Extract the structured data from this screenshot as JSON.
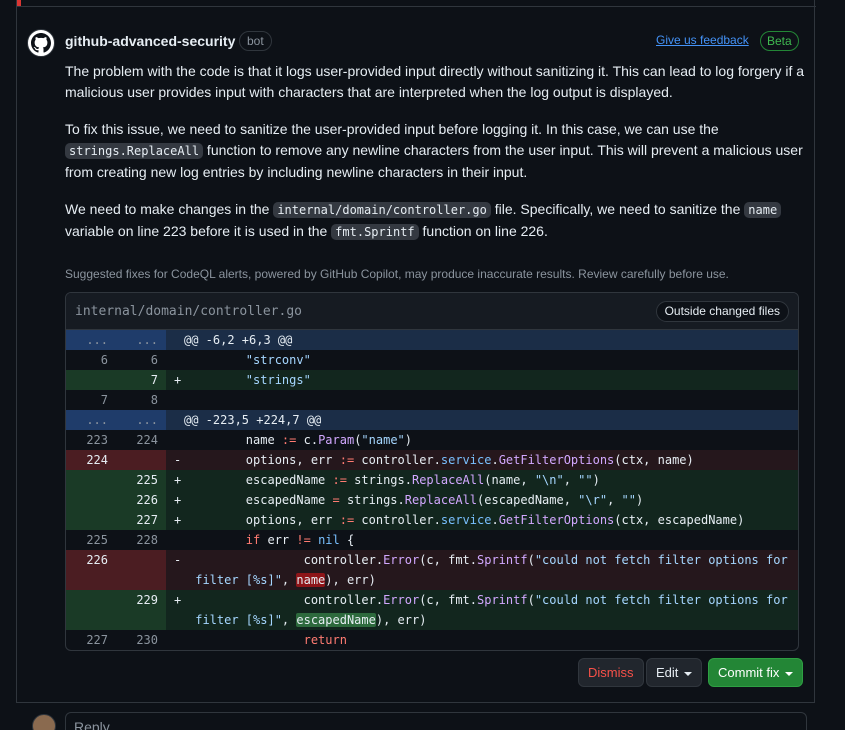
{
  "comment": {
    "author": "github-advanced-security",
    "author_badge": "bot",
    "feedback_link": "Give us feedback",
    "beta_badge": "Beta",
    "p1": "The problem with the code is that it logs user-provided input directly without sanitizing it. This can lead to log forgery if a malicious user provides input with characters that are interpreted when the log output is displayed.",
    "p2_a": "To fix this issue, we need to sanitize the user-provided input before logging it. In this case, we can use the ",
    "p2_code": "strings.ReplaceAll",
    "p2_b": " function to remove any newline characters from the user input. This will prevent a malicious user from creating new log entries by including newline characters in their input.",
    "p3_a": "We need to make changes in the ",
    "p3_code1": "internal/domain/controller.go",
    "p3_b": " file. Specifically, we need to sanitize the ",
    "p3_code2": "name",
    "p3_c": " variable on line 223 before it is used in the ",
    "p3_code3": "fmt.Sprintf",
    "p3_d": " function on line 226.",
    "disclaimer": "Suggested fixes for CodeQL alerts, powered by GitHub Copilot, may produce inaccurate results. Review carefully before use."
  },
  "diff": {
    "file_path": "internal/domain/controller.go",
    "outside_label": "Outside changed files",
    "hunk1": {
      "l1": "...",
      "l2": "...",
      "text": "@@ -6,2 +6,3 @@"
    },
    "hunk2": {
      "l1": "...",
      "l2": "...",
      "text": "@@ -223,5 +224,7 @@"
    },
    "rows": {
      "r1": {
        "l1": "6",
        "l2": "6",
        "sign": "",
        "text": "        \"strconv\""
      },
      "r2": {
        "l1": "",
        "l2": "7",
        "sign": "+",
        "text": "        \"strings\""
      },
      "r3": {
        "l1": "7",
        "l2": "8",
        "sign": "",
        "text": ""
      },
      "r4": {
        "l1": "223",
        "l2": "224"
      },
      "r5": {
        "l1": "224",
        "l2": "",
        "sign": "-"
      },
      "r6": {
        "l1": "",
        "l2": "225",
        "sign": "+"
      },
      "r7": {
        "l1": "",
        "l2": "226",
        "sign": "+"
      },
      "r8": {
        "l1": "",
        "l2": "227",
        "sign": "+"
      },
      "r9": {
        "l1": "225",
        "l2": "228",
        "sign": ""
      },
      "r10": {
        "l1": "226",
        "l2": "",
        "sign": "-"
      },
      "r11": {
        "l1": "",
        "l2": "229",
        "sign": "+"
      },
      "r12": {
        "l1": "227",
        "l2": "230",
        "sign": ""
      }
    }
  },
  "actions": {
    "dismiss": "Dismiss",
    "edit": "Edit",
    "commit": "Commit fix"
  },
  "reply": {
    "placeholder": "Reply..."
  }
}
